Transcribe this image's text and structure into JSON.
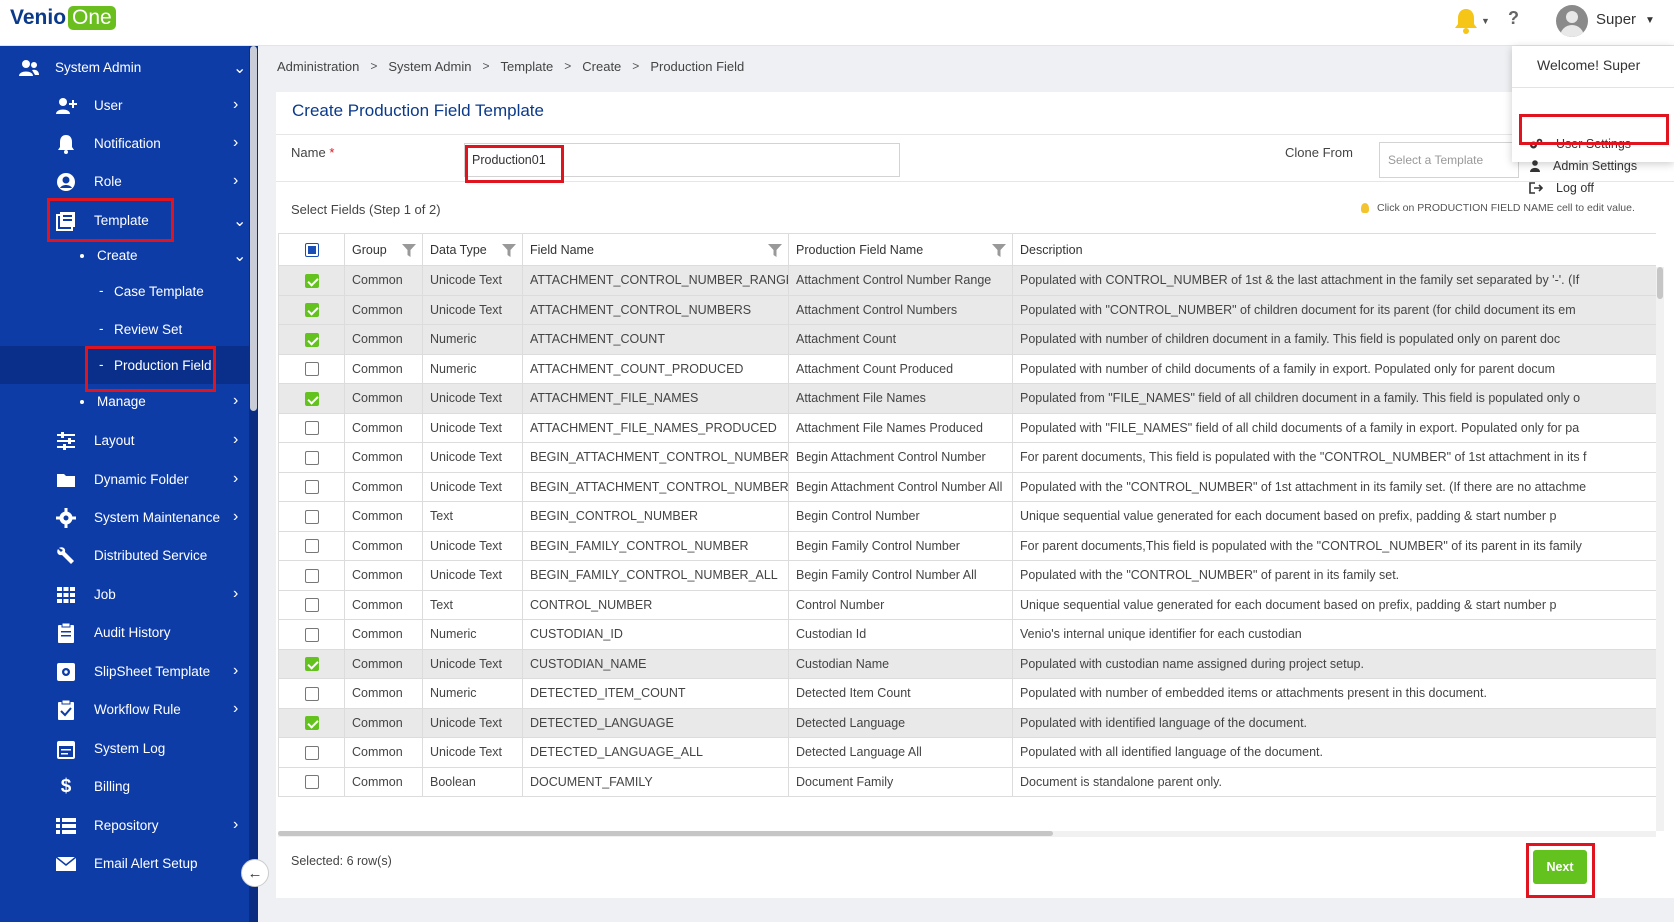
{
  "app": {
    "logo_text": "Venio",
    "logo_badge": "One",
    "user_name": "Super",
    "help_glyph": "?"
  },
  "user_menu": {
    "welcome": "Welcome! Super",
    "items": [
      {
        "label": "User Settings",
        "icon": "gears-icon"
      },
      {
        "label": "Admin Settings",
        "icon": "person-icon"
      },
      {
        "label": "Log off",
        "icon": "logoff-icon"
      }
    ]
  },
  "sidebar": {
    "system_admin": "System Admin",
    "user": "User",
    "notification": "Notification",
    "role": "Role",
    "template": "Template",
    "create": "Create",
    "case_template": "Case Template",
    "review_set": "Review Set",
    "production_field": "Production Field",
    "manage": "Manage",
    "layout": "Layout",
    "dynamic_folder": "Dynamic Folder",
    "system_maintenance": "System Maintenance",
    "distributed_service": "Distributed Service",
    "job": "Job",
    "audit_history": "Audit History",
    "slipsheet_template": "SlipSheet Template",
    "workflow_rule": "Workflow Rule",
    "system_log": "System Log",
    "billing": "Billing",
    "repository": "Repository",
    "email_alert_setup": "Email Alert Setup"
  },
  "breadcrumb": [
    "Administration",
    "System Admin",
    "Template",
    "Create",
    "Production Field"
  ],
  "page": {
    "title": "Create Production Field Template",
    "name_label": "Name",
    "required_mark": "*",
    "name_value": "Production01",
    "clone_label": "Clone From",
    "clone_placeholder": "Select a Template",
    "step_label": "Select Fields (Step 1 of 2)",
    "hint": "Click on PRODUCTION FIELD NAME cell to edit value.",
    "selected_count": "Selected: 6 row(s)",
    "next_label": "Next"
  },
  "table": {
    "headers": {
      "group": "Group",
      "data_type": "Data Type",
      "field_name": "Field Name",
      "production_field_name": "Production Field Name",
      "description": "Description"
    },
    "rows": [
      {
        "checked": true,
        "group": "Common",
        "type": "Unicode Text",
        "field": "ATTACHMENT_CONTROL_NUMBER_RANGE",
        "prod": "Attachment Control Number Range",
        "desc": "Populated with CONTROL_NUMBER of 1st & the last attachment in the family set separated by '-'. (If"
      },
      {
        "checked": true,
        "group": "Common",
        "type": "Unicode Text",
        "field": "ATTACHMENT_CONTROL_NUMBERS",
        "prod": "Attachment Control Numbers",
        "desc": "Populated with \"CONTROL_NUMBER\" of children document for its parent (for child document its em"
      },
      {
        "checked": true,
        "group": "Common",
        "type": "Numeric",
        "field": "ATTACHMENT_COUNT",
        "prod": "Attachment Count",
        "desc": "Populated with number of children document in a family. This field is populated only on parent doc"
      },
      {
        "checked": false,
        "group": "Common",
        "type": "Numeric",
        "field": "ATTACHMENT_COUNT_PRODUCED",
        "prod": "Attachment Count Produced",
        "desc": "Populated with number of child documents of a family in export. Populated only for parent docum"
      },
      {
        "checked": true,
        "group": "Common",
        "type": "Unicode Text",
        "field": "ATTACHMENT_FILE_NAMES",
        "prod": "Attachment File Names",
        "desc": "Populated from \"FILE_NAMES\" field of all children document in a family. This field is populated only o"
      },
      {
        "checked": false,
        "group": "Common",
        "type": "Unicode Text",
        "field": "ATTACHMENT_FILE_NAMES_PRODUCED",
        "prod": "Attachment File Names Produced",
        "desc": "Populated with \"FILE_NAMES\" field of all child documents of a family in export. Populated only for pa"
      },
      {
        "checked": false,
        "group": "Common",
        "type": "Unicode Text",
        "field": "BEGIN_ATTACHMENT_CONTROL_NUMBER",
        "prod": "Begin Attachment Control Number",
        "desc": "For parent documents, This field is populated with the \"CONTROL_NUMBER\" of 1st attachment in its f"
      },
      {
        "checked": false,
        "group": "Common",
        "type": "Unicode Text",
        "field": "BEGIN_ATTACHMENT_CONTROL_NUMBER_ALL",
        "prod": "Begin Attachment Control Number All",
        "desc": "Populated with the \"CONTROL_NUMBER\" of 1st attachment in its family set. (If there are no attachme"
      },
      {
        "checked": false,
        "group": "Common",
        "type": "Text",
        "field": "BEGIN_CONTROL_NUMBER",
        "prod": "Begin Control Number",
        "desc": "Unique sequential value generated for each document based on prefix, padding & start number p"
      },
      {
        "checked": false,
        "group": "Common",
        "type": "Unicode Text",
        "field": "BEGIN_FAMILY_CONTROL_NUMBER",
        "prod": "Begin Family Control Number",
        "desc": "For parent documents,This field is populated with the \"CONTROL_NUMBER\" of its parent in its family"
      },
      {
        "checked": false,
        "group": "Common",
        "type": "Unicode Text",
        "field": "BEGIN_FAMILY_CONTROL_NUMBER_ALL",
        "prod": "Begin Family Control Number All",
        "desc": "Populated with the \"CONTROL_NUMBER\" of parent in its family set."
      },
      {
        "checked": false,
        "group": "Common",
        "type": "Text",
        "field": "CONTROL_NUMBER",
        "prod": "Control Number",
        "desc": "Unique sequential value generated for each document based on prefix, padding & start number p"
      },
      {
        "checked": false,
        "group": "Common",
        "type": "Numeric",
        "field": "CUSTODIAN_ID",
        "prod": "Custodian Id",
        "desc": "Venio's internal unique identifier for each custodian"
      },
      {
        "checked": true,
        "group": "Common",
        "type": "Unicode Text",
        "field": "CUSTODIAN_NAME",
        "prod": "Custodian Name",
        "desc": "Populated with custodian name assigned during project setup."
      },
      {
        "checked": false,
        "group": "Common",
        "type": "Numeric",
        "field": "DETECTED_ITEM_COUNT",
        "prod": "Detected Item Count",
        "desc": "Populated with number of embedded items or attachments present in this document."
      },
      {
        "checked": true,
        "group": "Common",
        "type": "Unicode Text",
        "field": "DETECTED_LANGUAGE",
        "prod": "Detected Language",
        "desc": "Populated with identified language of the document."
      },
      {
        "checked": false,
        "group": "Common",
        "type": "Unicode Text",
        "field": "DETECTED_LANGUAGE_ALL",
        "prod": "Detected Language All",
        "desc": "Populated with all identified language of the document."
      },
      {
        "checked": false,
        "group": "Common",
        "type": "Boolean",
        "field": "DOCUMENT_FAMILY",
        "prod": "Document Family",
        "desc": "Document is standalone parent only."
      }
    ]
  },
  "colors": {
    "sidebar_bg": "#0e3ca6",
    "accent_green": "#64c21e",
    "title_blue": "#0b3a8a",
    "highlight_red": "#e0141e"
  }
}
